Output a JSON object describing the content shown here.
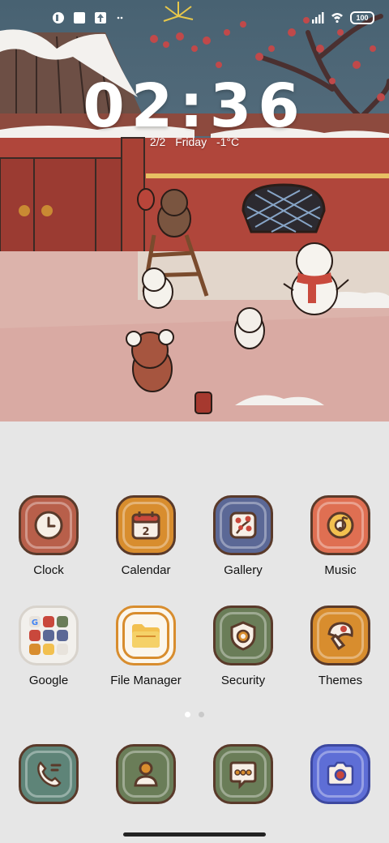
{
  "status_bar": {
    "icons_left": [
      "app-notification-icon",
      "square-notification-icon",
      "upload-icon",
      "more-dots-icon"
    ],
    "icons_right": [
      "signal-icon",
      "wifi-icon",
      "battery-icon"
    ],
    "battery": "100"
  },
  "lock": {
    "time": "02:36",
    "date": "2/2",
    "weekday": "Friday",
    "temperature": "-1°C"
  },
  "apps_row1": [
    {
      "label": "Clock",
      "icon": "clock-icon",
      "color": "#b85f4a"
    },
    {
      "label": "Calendar",
      "icon": "calendar-icon",
      "color": "#d88d2e",
      "badge": "2"
    },
    {
      "label": "Gallery",
      "icon": "gallery-icon",
      "color": "#5b6896"
    },
    {
      "label": "Music",
      "icon": "music-icon",
      "color": "#df6f52"
    }
  ],
  "apps_row2": [
    {
      "label": "Google",
      "icon": "google-folder-icon",
      "color": "#f2f0ec"
    },
    {
      "label": "File Manager",
      "icon": "folder-icon",
      "color": "#fbf6ec"
    },
    {
      "label": "Security",
      "icon": "shield-icon",
      "color": "#6a7d58"
    },
    {
      "label": "Themes",
      "icon": "mushroom-icon",
      "color": "#d88d2e"
    }
  ],
  "dock": [
    {
      "icon": "phone-icon",
      "color": "#5e8478"
    },
    {
      "icon": "contacts-icon",
      "color": "#6a7d58"
    },
    {
      "icon": "messages-icon",
      "color": "#6a7d58"
    },
    {
      "icon": "camera-icon",
      "color": "#5e6ed6"
    }
  ],
  "page_indicator": {
    "pages": 2,
    "current": 1
  }
}
